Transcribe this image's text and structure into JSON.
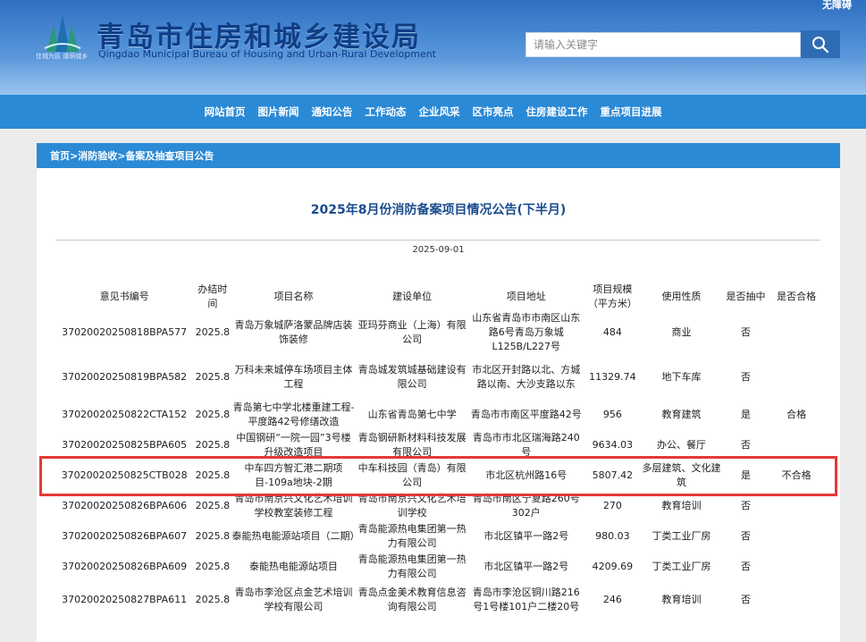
{
  "header": {
    "site_title": "青岛市住房和城乡建设局",
    "site_subtitle": "Qingdao Municipal Bureau of Housing and Urban-Rural Development",
    "slogan": "住城为民 谱荫城乡",
    "accessibility_label": "无障碍",
    "search": {
      "placeholder": "请输入关键字"
    },
    "logo_icon": "building-logo-icon",
    "search_icon": "magnifier-icon",
    "colors": {
      "banner": "#4e8ed6",
      "title": "#0f3e86",
      "nav": "#2b8ad6"
    }
  },
  "nav": [
    {
      "label": "网站首页"
    },
    {
      "label": "图片新闻"
    },
    {
      "label": "通知公告"
    },
    {
      "label": "工作动态"
    },
    {
      "label": "企业风采"
    },
    {
      "label": "区市亮点"
    },
    {
      "label": "住房建设工作"
    },
    {
      "label": "重点项目进展"
    }
  ],
  "breadcrumb": [
    {
      "label": "首页"
    },
    {
      "label": ">"
    },
    {
      "label": "消防验收"
    },
    {
      "label": ">"
    },
    {
      "label": "备案及抽查项目公告"
    }
  ],
  "article": {
    "title": "2025年8月份消防备案项目情况公告(下半月)",
    "date": "2025-09-01",
    "title_color": "#1a4c8e"
  },
  "table": {
    "columns": [
      "意见书编号",
      "办结时间",
      "项目名称",
      "建设单位",
      "项目地址",
      "项目规模（平方米）",
      "使用性质",
      "是否抽中",
      "是否合格"
    ],
    "rows": [
      [
        "37020020250818BPA577",
        "2025.8",
        "青岛万象城萨洛蒙品牌店装饰装修",
        "亚玛芬商业（上海）有限公司",
        "山东省青岛市市南区山东路6号青岛万象城L125B/L227号",
        "484",
        "商业",
        "否",
        ""
      ],
      [
        "37020020250819BPA582",
        "2025.8",
        "万科未来城停车场项目主体工程",
        "青岛城发筑城基础建设有限公司",
        "市北区开封路以北、方城路以南、大沙支路以东",
        "11329.74",
        "地下车库",
        "否",
        ""
      ],
      [
        "37020020250822CTA152",
        "2025.8",
        "青岛第七中学北楼重建工程-平度路42号修缮改造",
        "山东省青岛第七中学",
        "青岛市市南区平度路42号",
        "956",
        "教育建筑",
        "是",
        "合格"
      ],
      [
        "37020020250825BPA605",
        "2025.8",
        "中国钢研“一院一园”3号楼升级改造项目",
        "青岛钢研新材料科技发展有限公司",
        "青岛市市北区瑞海路240号",
        "9634.03",
        "办公、餐厅",
        "否",
        ""
      ],
      [
        "37020020250825CTB028",
        "2025.8",
        "中车四方智汇港二期项目-109a地块-2期",
        "中车科技园（青岛）有限公司",
        "市北区杭州路16号",
        "5807.42",
        "多层建筑、文化建筑",
        "是",
        "不合格"
      ],
      [
        "37020020250826BPA606",
        "2025.8",
        "青岛市南京兴文化艺术培训学校教室装修工程",
        "青岛市南京兴文化艺术培训学校",
        "青岛市南区宁夏路260号302户",
        "270",
        "教育培训",
        "否",
        ""
      ],
      [
        "37020020250826BPA607",
        "2025.8",
        "泰能热电能源站项目（二期）",
        "青岛能源热电集团第一热力有限公司",
        "市北区镇平一路2号",
        "980.03",
        "丁类工业厂房",
        "否",
        ""
      ],
      [
        "37020020250826BPA609",
        "2025.8",
        "泰能热电能源站项目",
        "青岛能源热电集团第一热力有限公司",
        "市北区镇平一路2号",
        "4209.69",
        "丁类工业厂房",
        "否",
        ""
      ],
      [
        "37020020250827BPA611",
        "2025.8",
        "青岛市李沧区点金艺术培训学校有限公司",
        "青岛点金美术教育信息咨询有限公司",
        "青岛市李沧区铜川路216号1号楼101户二楼20号",
        "246",
        "教育培训",
        "否",
        ""
      ]
    ],
    "highlight_color": "#e53935"
  }
}
